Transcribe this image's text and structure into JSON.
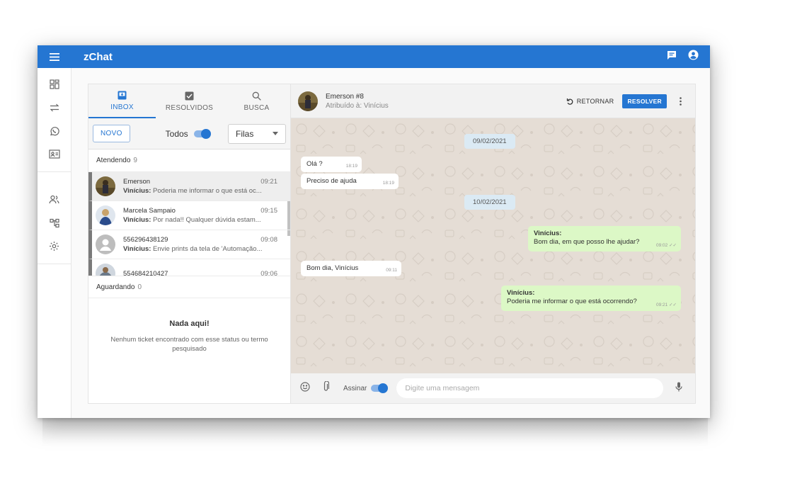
{
  "app": {
    "title": "zChat"
  },
  "colors": {
    "primary": "#2576d2",
    "chat_bg": "#e5ddd5",
    "outgoing": "#dcf8c6"
  },
  "rail": [
    "dashboard-icon",
    "transfer-icon",
    "whatsapp-icon",
    "contacts-card-icon",
    "users-icon",
    "queues-icon",
    "settings-icon"
  ],
  "tabs": [
    {
      "label": "INBOX",
      "icon": "inbox-icon"
    },
    {
      "label": "RESOLVIDOS",
      "icon": "check-box-icon"
    },
    {
      "label": "BUSCA",
      "icon": "search-icon"
    }
  ],
  "toolbar": {
    "novo": "NOVO",
    "todos": "Todos",
    "filas": "Filas"
  },
  "attending": {
    "label": "Atendendo",
    "count": "9",
    "items": [
      {
        "name": "Emerson",
        "time": "09:21",
        "author": "Vinícius:",
        "preview": " Poderia me informar o que está oc..."
      },
      {
        "name": "Marcela Sampaio",
        "time": "09:15",
        "author": "Vinícius:",
        "preview": " Por nada!! Qualquer dúvida estam..."
      },
      {
        "name": "556296438129",
        "time": "09:08",
        "author": "Vinícius:",
        "preview": " Envie prints da tela de 'Automação..."
      },
      {
        "name": "554684210427",
        "time": "09:06",
        "author": "",
        "preview": ""
      }
    ]
  },
  "waiting": {
    "label": "Aguardando",
    "count": "0",
    "empty_title": "Nada aqui!",
    "empty_text": "Nenhum ticket encontrado com esse status ou termo pesquisado"
  },
  "chat": {
    "contact": "Emerson #8",
    "assigned": "Atribuído à: Vinícius",
    "retornar": "RETORNAR",
    "resolver": "RESOLVER",
    "dates": [
      "09/02/2021",
      "10/02/2021"
    ],
    "messages": [
      {
        "text": "Olá ?",
        "time": "18:19"
      },
      {
        "text": "Preciso de ajuda",
        "time": "18:19"
      },
      {
        "author": "Vinícius:",
        "text": "Bom dia, em que posso lhe ajudar?",
        "time": "09:02"
      },
      {
        "text": "Bom dia, Vinícius",
        "time": "09:11"
      },
      {
        "author": "Vinícius:",
        "text": "Poderia me informar o que está ocorrendo?",
        "time": "09:21"
      }
    ],
    "assinar": "Assinar",
    "placeholder": "Digite uma mensagem"
  }
}
